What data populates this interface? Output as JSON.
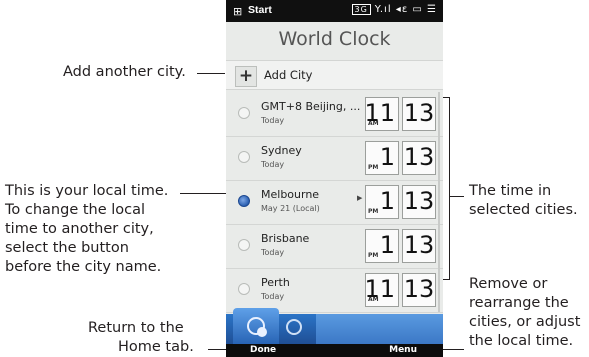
{
  "annotations": {
    "add_city": "Add another city.",
    "local_time": [
      "This is your local time.",
      "To change the local",
      "time to another city,",
      "select the button",
      "before the city name."
    ],
    "return_home": [
      "Return to the",
      "Home tab."
    ],
    "time_in_cities": [
      "The time in",
      "selected cities."
    ],
    "remove": [
      "Remove or",
      "rearrange the",
      "cities, or adjust",
      "the local time."
    ]
  },
  "statusbar": {
    "start_label": "Start",
    "network": "3G",
    "icons": "Y.ıl ◂ɛ ▭ ☰"
  },
  "screen": {
    "title": "World Clock",
    "add_city_label": "Add City",
    "cities": [
      {
        "name": "GMT+8 Beijing, ...",
        "sub": "Today",
        "ampm": "AM",
        "hour": "11",
        "minute": "13",
        "selected": false
      },
      {
        "name": "Sydney",
        "sub": "Today",
        "ampm": "PM",
        "hour": "1",
        "minute": "13",
        "selected": false
      },
      {
        "name": "Melbourne",
        "sub": "May 21  (Local)",
        "ampm": "PM",
        "hour": "1",
        "minute": "13",
        "selected": true
      },
      {
        "name": "Brisbane",
        "sub": "Today",
        "ampm": "PM",
        "hour": "1",
        "minute": "13",
        "selected": false
      },
      {
        "name": "Perth",
        "sub": "Today",
        "ampm": "AM",
        "hour": "11",
        "minute": "13",
        "selected": false
      }
    ]
  },
  "softkeys": {
    "left": "Done",
    "right": "Menu"
  },
  "icons": {
    "tab_worldclock": "world-clock-icon",
    "tab_alarm": "alarm-icon",
    "start": "windows-logo-icon",
    "add": "plus-icon"
  },
  "colors": {
    "tab_blue": "#2b74c7",
    "selected_radio": "#2a5fb0"
  }
}
